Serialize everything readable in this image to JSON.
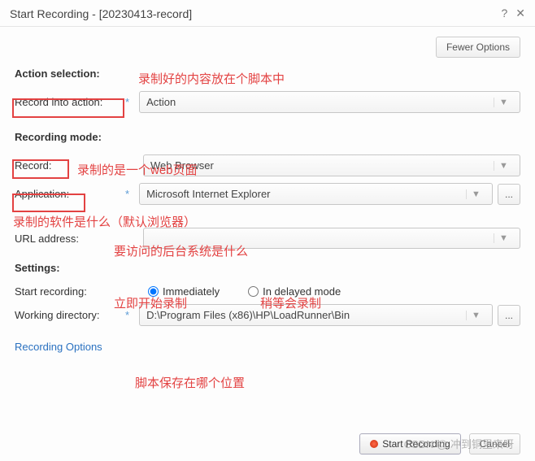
{
  "window": {
    "title": "Start Recording - [20230413-record]"
  },
  "buttons": {
    "fewer_options": "Fewer Options",
    "dots": "...",
    "start_recording_btn": "Start Recording",
    "cancel": "Cancel"
  },
  "labels": {
    "action_selection": "Action selection:",
    "record_into_action": "Record into action:",
    "recording_mode": "Recording mode:",
    "record": "Record:",
    "application": "Application:",
    "url_address": "URL address:",
    "settings": "Settings:",
    "start_recording": "Start recording:",
    "working_directory": "Working directory:",
    "recording_options": "Recording Options"
  },
  "values": {
    "action": "Action",
    "record_mode": "Web Browser",
    "application": "Microsoft Internet Explorer",
    "url": "",
    "working_dir": "D:\\Program Files (x86)\\HP\\LoadRunner\\Bin"
  },
  "radio": {
    "immediately": "Immediately",
    "delayed": "In delayed mode"
  },
  "annotations": {
    "a1": "录制好的内容放在个脚本中",
    "a2": "录制的是一个web页面",
    "a3": "录制的软件是什么（默认浏览器）",
    "a4": "要访问的后台系统是什么",
    "a5": "立即开始录制",
    "a6": "稍等会录制",
    "a7": "脚本保存在哪个位置"
  },
  "watermark": "CSDN @.冲到铜里来呀"
}
